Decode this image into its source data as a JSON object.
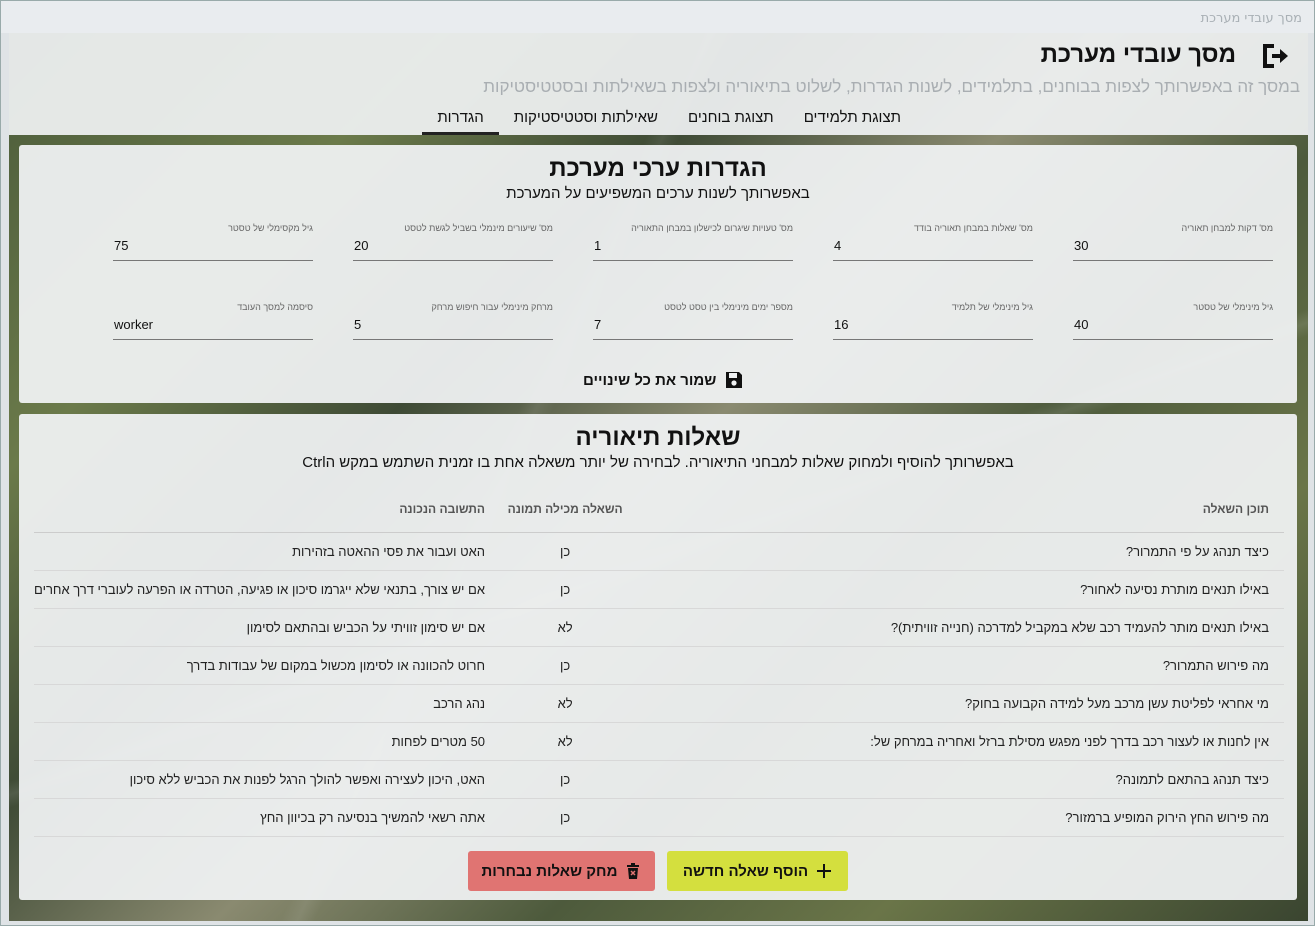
{
  "window": {
    "title": "מסך עובדי מערכת"
  },
  "header": {
    "title": "מסך עובדי מערכת",
    "subtitle": "במסך זה באפשרותך לצפות בבוחנים, בתלמידים, לשנות הגדרות, לשלוט בתיאוריה ולצפות בשאילתות ובסטטיסטיקות",
    "logout_icon": "logout-icon",
    "tabs": [
      {
        "label": "תצוגת תלמידים"
      },
      {
        "label": "תצוגת בוחנים"
      },
      {
        "label": "שאילתות וסטטיסטיקות"
      },
      {
        "label": "הגדרות",
        "active": true
      }
    ]
  },
  "settings": {
    "title": "הגדרות ערכי מערכת",
    "subtitle": "באפשרותך לשנות ערכים המשפיעים על המערכת",
    "fields": [
      {
        "label": "מס' דקות למבחן תאוריה",
        "value": "30"
      },
      {
        "label": "מס' שאלות במבחן תאוריה בודד",
        "value": "4"
      },
      {
        "label": "מס' טעויות שיגרום לכישלון במבחן התאוריה",
        "value": "1"
      },
      {
        "label": "מס' שיעורים מינמלי בשביל לגשת לטסט",
        "value": "20"
      },
      {
        "label": "גיל מקסימלי של טסטר",
        "value": "75"
      },
      {
        "label": "גיל מינימלי של טסטר",
        "value": "40"
      },
      {
        "label": "גיל מינימלי של תלמיד",
        "value": "16"
      },
      {
        "label": "מספר ימים מינימלי בין טסט לטסט",
        "value": "7"
      },
      {
        "label": "מרחק מינימלי עבור חיפוש מרחק",
        "value": "5"
      },
      {
        "label": "סיסמה למסך העובד",
        "value": "worker"
      }
    ],
    "save_label": "שמור את כל שינויים",
    "save_icon": "save-icon"
  },
  "theory": {
    "title": "שאלות תיאוריה",
    "subtitle": "באפשרותך להוסיף ולמחוק שאלות למבחני התיאוריה. לבחירה של יותר משאלה אחת בו זמנית השתמש במקש הCtrl",
    "columns": {
      "question": "תוכן השאלה",
      "has_image": "השאלה מכילה תמונה",
      "answer": "התשובה הנכונה"
    },
    "rows": [
      {
        "question": "כיצד תנהג על פי התמרור?",
        "has_image": "כן",
        "answer": "האט ועבור את פסי ההאטה בזהירות"
      },
      {
        "question": "באילו תנאים מותרת נסיעה לאחור?",
        "has_image": "כן",
        "answer": "אם יש צורך, בתנאי שלא ייגרמו סיכון או פגיעה, הטרדה או הפרעה לעוברי דרך אחרים"
      },
      {
        "question": "באילו תנאים מותר להעמיד רכב שלא במקביל למדרכה (חנייה זוויתית)?",
        "has_image": "לא",
        "answer": "אם יש סימון זוויתי על הכביש ובהתאם לסימון"
      },
      {
        "question": "מה פירוש התמרור?",
        "has_image": "כן",
        "answer": "חרוט להכוונה או לסימון מכשול במקום של עבודות בדרך"
      },
      {
        "question": "מי אחראי לפליטת עשן מרכב מעל למידה הקבועה בחוק?",
        "has_image": "לא",
        "answer": "נהג הרכב"
      },
      {
        "question": "אין לחנות או לעצור רכב בדרך לפני מפגש מסילת ברזל ואחריה במרחק של:",
        "has_image": "לא",
        "answer": "50 מטרים לפחות"
      },
      {
        "question": "כיצד תנהג בהתאם לתמונה?",
        "has_image": "כן",
        "answer": "האט, היכון לעצירה ואפשר להולך הרגל לפנות את הכביש ללא סיכון"
      },
      {
        "question": "מה פירוש החץ הירוק המופיע ברמזור?",
        "has_image": "כן",
        "answer": "אתה רשאי להמשיך בנסיעה רק בכיוון החץ"
      }
    ],
    "add_label": "הוסף שאלה חדשה",
    "add_icon": "plus-icon",
    "delete_label": "מחק שאלות נבחרות",
    "delete_icon": "trash-icon"
  }
}
